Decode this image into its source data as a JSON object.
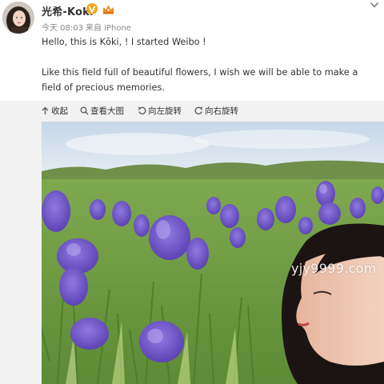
{
  "post": {
    "username": "光希-Koki",
    "time": "今天 08:03",
    "source": "来自 iPhone",
    "text_line1": "Hello, this is Kōki, ! I started Weibo !",
    "text_line2": "Like this field full of beautiful flowers, I wish we will be able to make a field of precious memories."
  },
  "toolbar": {
    "collapse": "收起",
    "view_large": "查看大图",
    "rotate_left": "向左旋转",
    "rotate_right": "向右旋转"
  },
  "image": {
    "watermark": "yjy9999.com"
  },
  "icons": {
    "verified": "verified-badge-icon",
    "crown": "crown-icon",
    "dropdown": "chevron-down-icon",
    "collapse": "arrow-up-icon",
    "search": "magnifier-icon",
    "rotate_left": "rotate-left-icon",
    "rotate_right": "rotate-right-icon"
  },
  "colors": {
    "verified": "#f5a623",
    "crown": "#f08a24",
    "meta_text": "#888888",
    "toolbar_bg": "#f2f2f2",
    "iris_purple": "#6b4fc2"
  }
}
